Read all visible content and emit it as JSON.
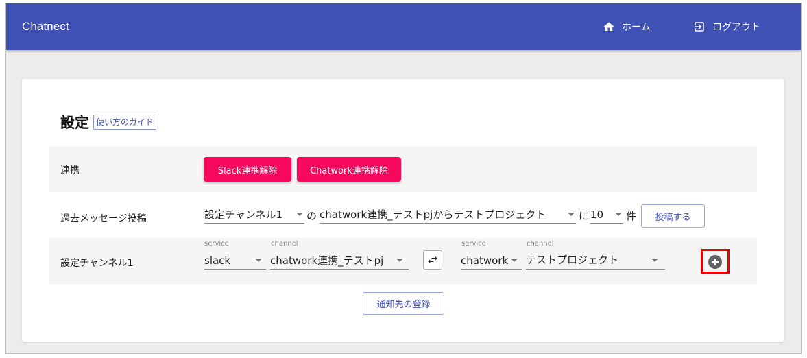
{
  "header": {
    "app_title": "Chatnect",
    "home_label": "ホーム",
    "logout_label": "ログアウト",
    "bar_color": "#3f51b5"
  },
  "settings": {
    "title": "設定",
    "guide_label": "使い方のガイド"
  },
  "integration": {
    "label": "連携",
    "slack_unlink_label": "Slack連携解除",
    "chatwork_unlink_label": "Chatwork連携解除",
    "button_color": "#f5095d"
  },
  "past_messages": {
    "label": "過去メッセージ投稿",
    "channel_select": "設定チャンネル1",
    "particle_no": "の",
    "source_select": "chatwork連携_テストpjからテストプロジェクト",
    "particle_ni": "に",
    "count_select": "10",
    "unit": "件",
    "post_label": "投稿する"
  },
  "channel_setting": {
    "label": "設定チャンネル1",
    "left_service_label": "service",
    "left_service": "slack",
    "left_channel_label": "channel",
    "left_channel": "chatwork連携_テストpj",
    "right_service_label": "service",
    "right_service": "chatwork",
    "right_channel_label": "channel",
    "right_channel": "テストプロジェクト",
    "swap_icon": "swap-horizontal-icon",
    "add_icon": "add-circle-icon",
    "highlight_color": "#e60000"
  },
  "register_label": "通知先の登録"
}
